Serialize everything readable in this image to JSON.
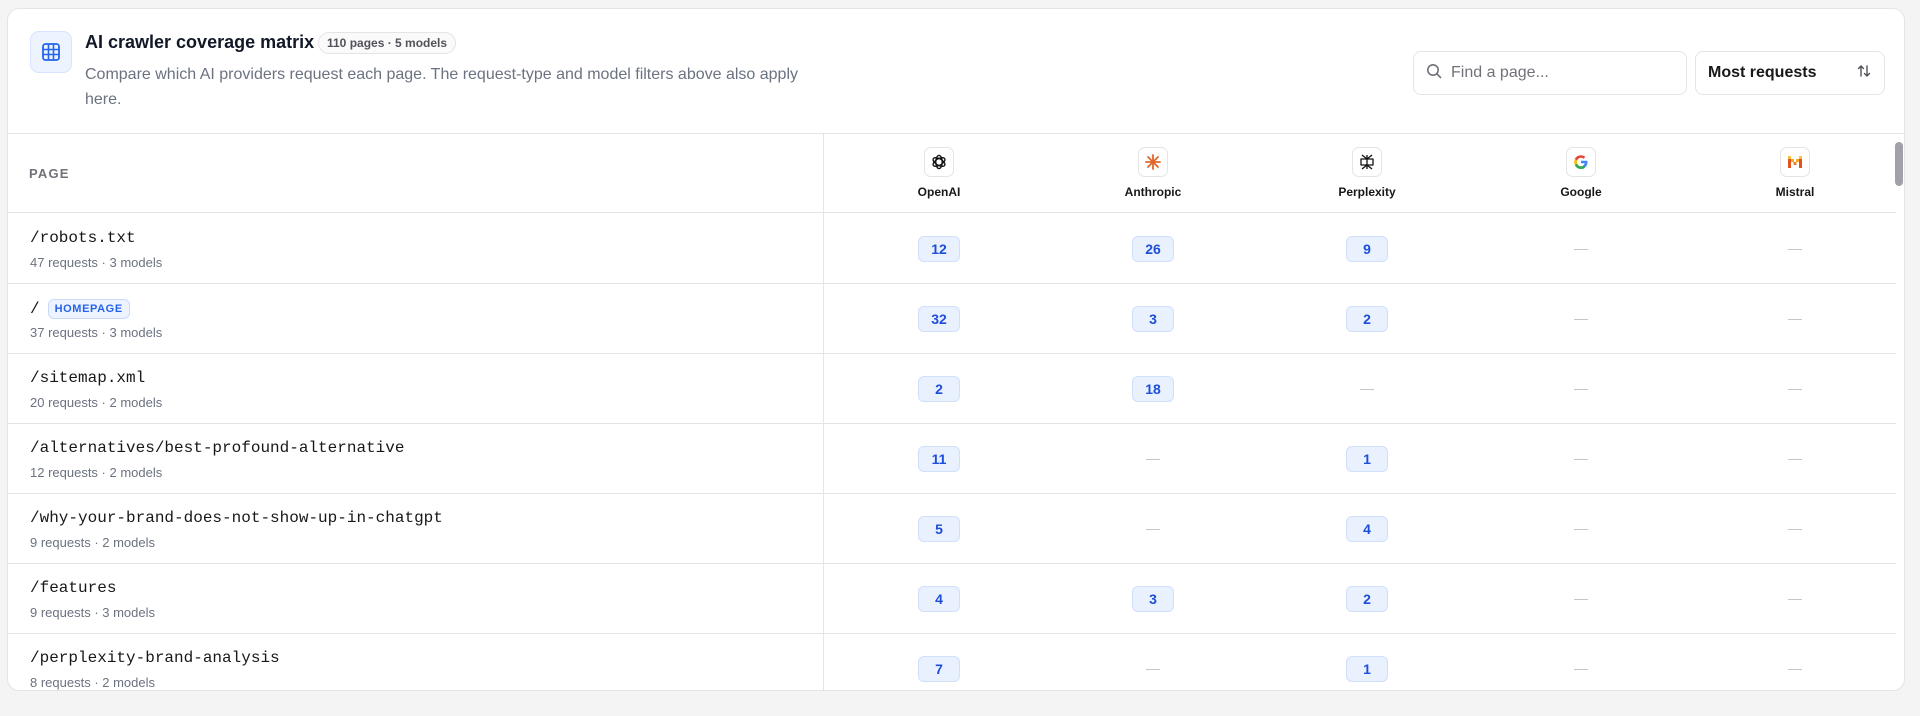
{
  "header": {
    "title": "AI crawler coverage matrix",
    "count_badge": "110 pages · 5 models",
    "description": "Compare which AI providers request each page. The request-type and model filters above also apply here.",
    "icon": "grid-table-icon",
    "accent_color": "#2563eb"
  },
  "search": {
    "placeholder": "Find a page...",
    "value": "",
    "icon": "search-icon"
  },
  "sort": {
    "label": "Most requests",
    "icon": "sort-arrows-icon"
  },
  "table": {
    "page_column_label": "PAGE",
    "providers": [
      {
        "name": "OpenAI",
        "icon": "openai-icon"
      },
      {
        "name": "Anthropic",
        "icon": "anthropic-icon"
      },
      {
        "name": "Perplexity",
        "icon": "perplexity-icon"
      },
      {
        "name": "Google",
        "icon": "google-icon"
      },
      {
        "name": "Mistral",
        "icon": "mistral-icon"
      }
    ],
    "empty_marker": "—",
    "rows": [
      {
        "path": "/robots.txt",
        "badge": null,
        "meta": "47 requests · 3 models",
        "counts": [
          "12",
          "26",
          "9",
          null,
          null
        ]
      },
      {
        "path": "/",
        "badge": "HOMEPAGE",
        "meta": "37 requests · 3 models",
        "counts": [
          "32",
          "3",
          "2",
          null,
          null
        ]
      },
      {
        "path": "/sitemap.xml",
        "badge": null,
        "meta": "20 requests · 2 models",
        "counts": [
          "2",
          "18",
          null,
          null,
          null
        ]
      },
      {
        "path": "/alternatives/best-profound-alternative",
        "badge": null,
        "meta": "12 requests · 2 models",
        "counts": [
          "11",
          null,
          "1",
          null,
          null
        ]
      },
      {
        "path": "/why-your-brand-does-not-show-up-in-chatgpt",
        "badge": null,
        "meta": "9 requests · 2 models",
        "counts": [
          "5",
          null,
          "4",
          null,
          null
        ]
      },
      {
        "path": "/features",
        "badge": null,
        "meta": "9 requests · 3 models",
        "counts": [
          "4",
          "3",
          "2",
          null,
          null
        ]
      },
      {
        "path": "/perplexity-brand-analysis",
        "badge": null,
        "meta": "8 requests · 2 models",
        "counts": [
          "7",
          null,
          "1",
          null,
          null
        ]
      }
    ]
  }
}
